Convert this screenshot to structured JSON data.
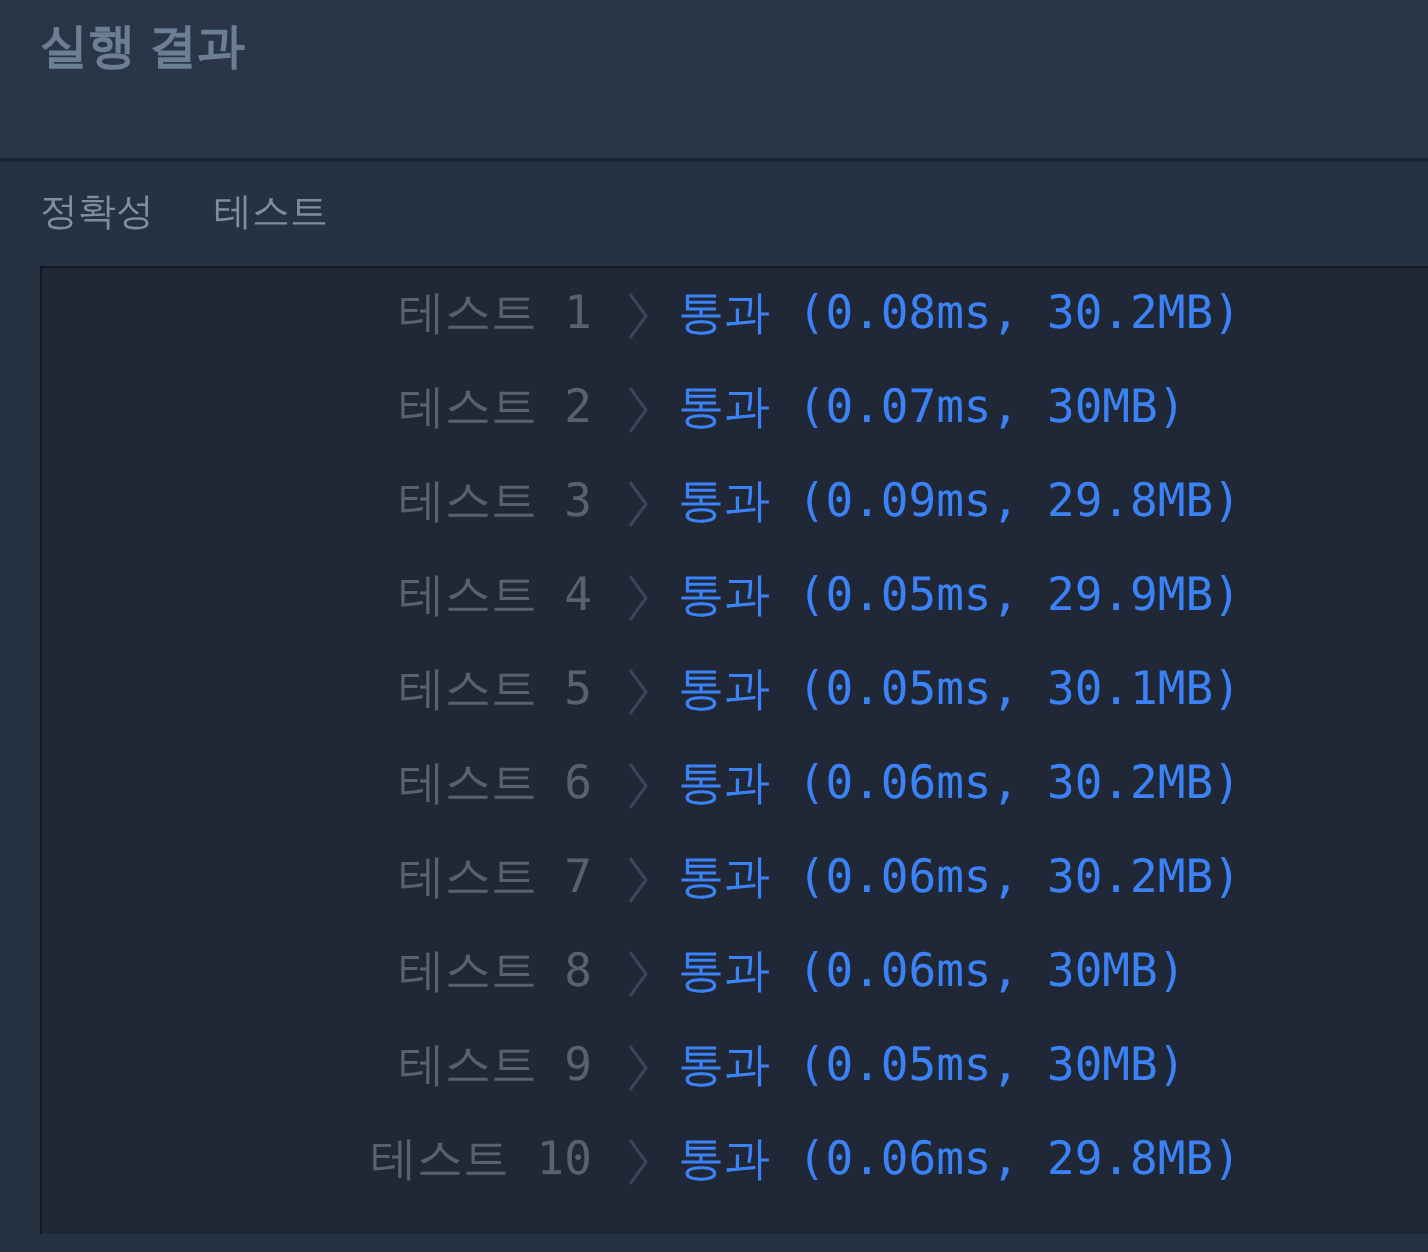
{
  "title": "실행 결과",
  "tabs": [
    "정확성",
    "테스트"
  ],
  "results": [
    {
      "label": "테스트 1",
      "result": "통과 (0.08ms, 30.2MB)"
    },
    {
      "label": "테스트 2",
      "result": "통과 (0.07ms, 30MB)"
    },
    {
      "label": "테스트 3",
      "result": "통과 (0.09ms, 29.8MB)"
    },
    {
      "label": "테스트 4",
      "result": "통과 (0.05ms, 29.9MB)"
    },
    {
      "label": "테스트 5",
      "result": "통과 (0.05ms, 30.1MB)"
    },
    {
      "label": "테스트 6",
      "result": "통과 (0.06ms, 30.2MB)"
    },
    {
      "label": "테스트 7",
      "result": "통과 (0.06ms, 30.2MB)"
    },
    {
      "label": "테스트 8",
      "result": "통과 (0.06ms, 30MB)"
    },
    {
      "label": "테스트 9",
      "result": "통과 (0.05ms, 30MB)"
    },
    {
      "label": "테스트 10",
      "result": "통과 (0.06ms, 29.8MB)"
    }
  ]
}
